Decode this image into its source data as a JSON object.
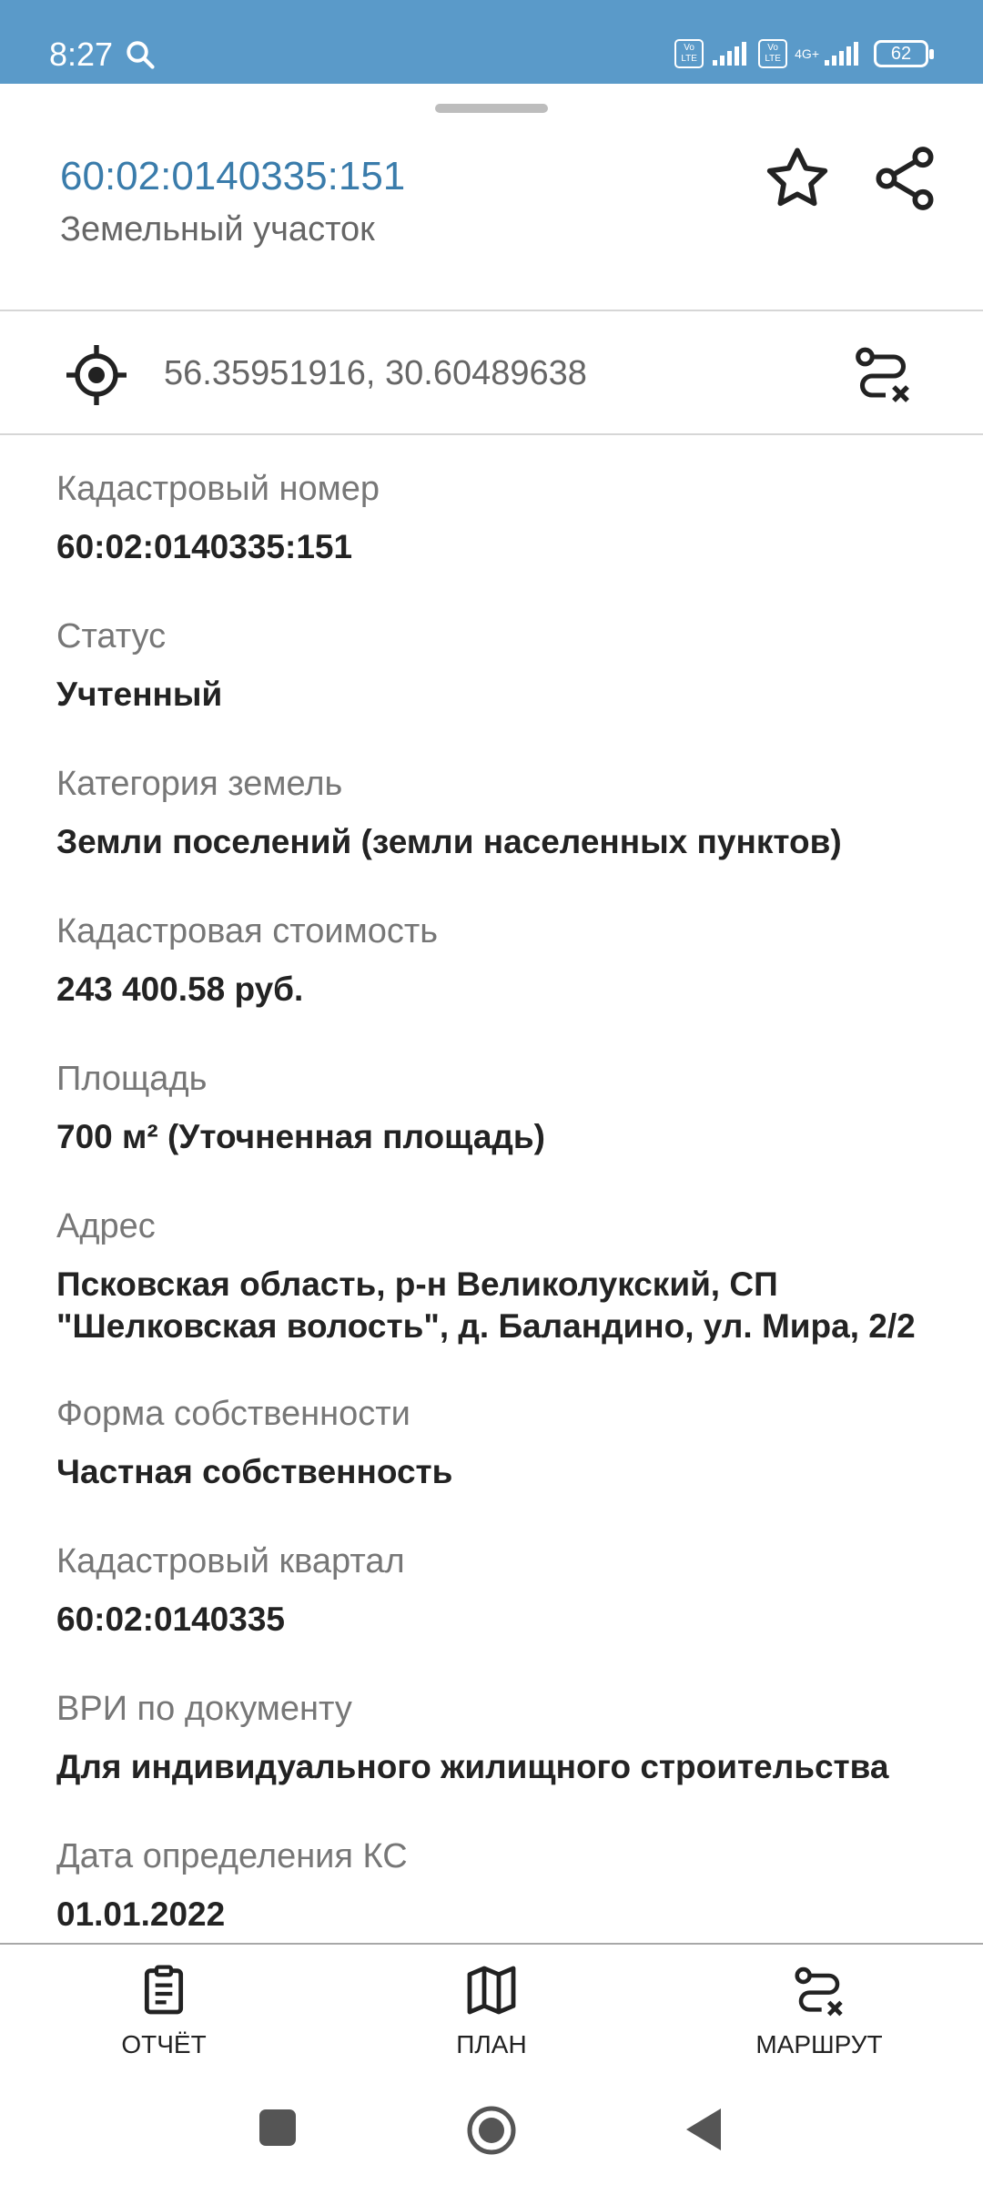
{
  "status_bar": {
    "time": "8:27",
    "volte_1": "Vo LTE",
    "volte_2": "Vo LTE",
    "network": "4G+",
    "battery": "62"
  },
  "header": {
    "title": "60:02:0140335:151",
    "subtitle": "Земельный участок",
    "star_icon": "star-outline-icon",
    "share_icon": "share-icon"
  },
  "location": {
    "coordinates": "56.35951916, 30.60489638",
    "locate_icon": "crosshair-icon",
    "route_icon": "route-clear-icon"
  },
  "fields": [
    {
      "label": "Кадастровый номер",
      "value": "60:02:0140335:151"
    },
    {
      "label": "Статус",
      "value": "Учтенный"
    },
    {
      "label": "Категория земель",
      "value": "Земли поселений (земли населенных пунктов)"
    },
    {
      "label": "Кадастровая стоимость",
      "value": "243 400.58 руб."
    },
    {
      "label": "Площадь",
      "value": "700 м² (Уточненная площадь)"
    },
    {
      "label": "Адрес",
      "value": "Псковская область, р-н Великолукский, СП \"Шелковская волость\", д. Баландино, ул. Мира, 2/2"
    },
    {
      "label": "Форма собственности",
      "value": "Частная собственность"
    },
    {
      "label": "Кадастровый квартал",
      "value": "60:02:0140335"
    },
    {
      "label": "ВРИ по документу",
      "value": "Для индивидуального жилищного строительства"
    },
    {
      "label": "Дата определения КС",
      "value": "01.01.2022"
    }
  ],
  "bottom_nav": [
    {
      "label": "ОТЧЁТ",
      "icon": "clipboard-icon"
    },
    {
      "label": "ПЛАН",
      "icon": "map-icon"
    },
    {
      "label": "МАРШРУТ",
      "icon": "route-icon"
    }
  ],
  "colors": {
    "status_bar": "#5a9ac9",
    "title": "#3a7cab"
  }
}
